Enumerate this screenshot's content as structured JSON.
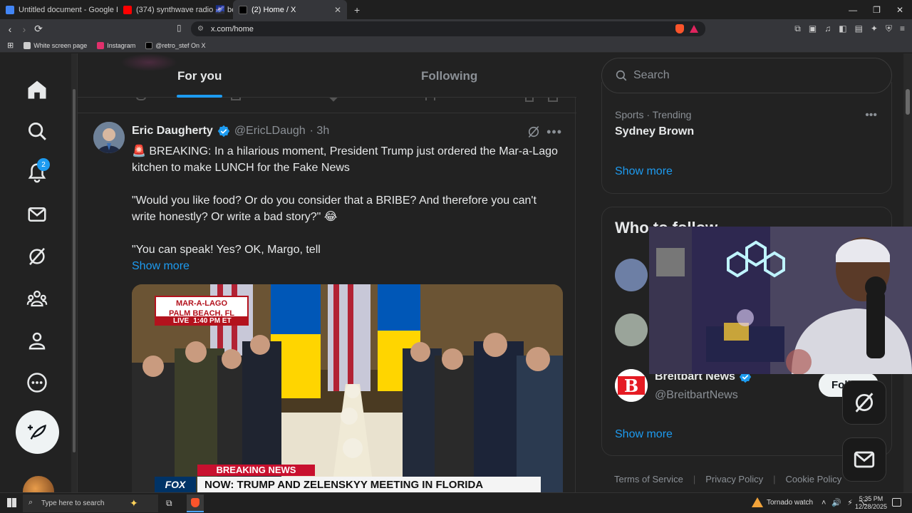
{
  "browser": {
    "tabs": [
      {
        "title": "Untitled document - Google Docs",
        "favicon_color": "#4285f4"
      },
      {
        "title": "(374) synthwave radio 🌌 beats t",
        "favicon_color": "#ff0000"
      },
      {
        "title": "(2) Home / X",
        "favicon_color": "#000000",
        "close": "✕"
      }
    ],
    "new_tab": "+",
    "window_controls": {
      "minimize": "—",
      "restore": "❐",
      "close": "✕"
    },
    "url": "x.com/home",
    "bookmarks": [
      {
        "label": "White screen page",
        "icon_color": "#cccccc"
      },
      {
        "label": "Instagram",
        "icon_color": "#e1306c"
      },
      {
        "label": "@retro_stef On X",
        "icon_color": "#000000"
      }
    ]
  },
  "nav": {
    "notifications_badge": "2",
    "items": [
      "home-icon",
      "search-icon",
      "notifications-icon",
      "messages-icon",
      "grok-icon",
      "communities-icon",
      "profile-icon",
      "more-icon"
    ]
  },
  "feed": {
    "tabs": {
      "for_you": "For you",
      "following": "Following"
    },
    "tweet": {
      "author_name": "Eric Daugherty",
      "author_handle": "@EricLDaugh",
      "time": "· 3h",
      "paragraphs": [
        "🚨 BREAKING: In a hilarious moment, President Trump just ordered the Mar-a-Lago kitchen to make LUNCH for the Fake News",
        "\"Would you like food? Or do you consider that a BRIBE? And therefore you can't write honestly? Or write a bad story?\" 😂",
        "\"You can speak! Yes? OK, Margo, tell"
      ],
      "show_more": "Show more",
      "media": {
        "banner_location_1": "MAR-A-LAGO",
        "banner_location_2": "PALM BEACH, FL",
        "live": "LIVE",
        "live_time": "1:40 PM ET",
        "breaking": "BREAKING NEWS",
        "network": "FOX",
        "headline": "NOW: TRUMP AND ZELENSKYY MEETING IN FLORIDA"
      }
    }
  },
  "sidebar": {
    "search_placeholder": "Search",
    "trend": {
      "meta": "Sports · Trending",
      "name": "Sydney Brown",
      "show_more": "Show more"
    },
    "who_to_follow": {
      "title": "Who to follow",
      "accounts": [
        {
          "name": "Breitbart News",
          "handle": "@BreitbartNews",
          "follow": "Follow"
        }
      ],
      "show_more": "Show more"
    },
    "footer": [
      "Terms of Service",
      "Privacy Policy",
      "Cookie Policy"
    ]
  },
  "taskbar": {
    "search_placeholder": "Type here to search",
    "weather": "Tornado watch",
    "time": "5:35 PM",
    "date": "12/28/2025"
  },
  "colors": {
    "accent": "#1d9bf0",
    "background": "#222222"
  }
}
